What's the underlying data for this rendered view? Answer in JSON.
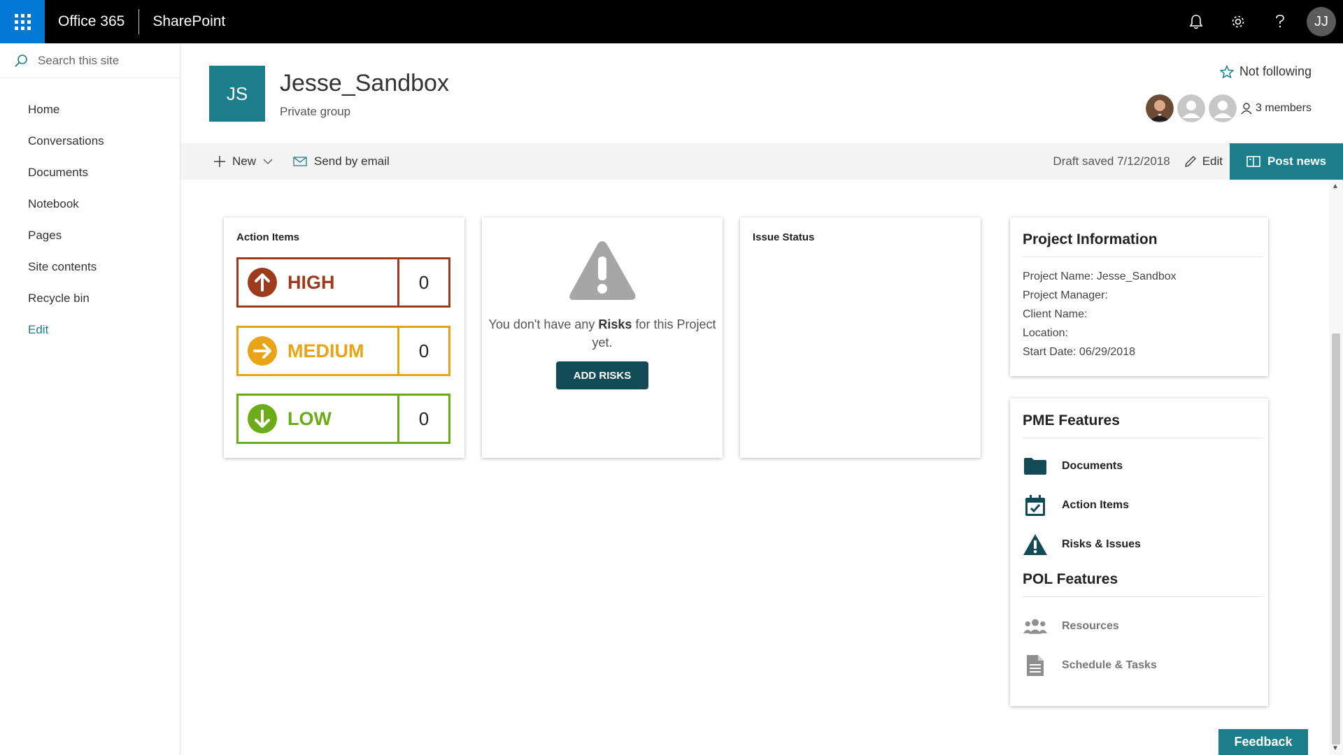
{
  "suite": {
    "app_name": "Office 365",
    "product": "SharePoint",
    "user_initials": "JJ"
  },
  "leftnav": {
    "search_placeholder": "Search this site",
    "items": [
      "Home",
      "Conversations",
      "Documents",
      "Notebook",
      "Pages",
      "Site contents",
      "Recycle bin"
    ],
    "edit_label": "Edit"
  },
  "header": {
    "logo_initials": "JS",
    "title": "Jesse_Sandbox",
    "subtitle": "Private group",
    "follow_label": "Not following",
    "members_label": "3 members"
  },
  "cmdbar": {
    "new_label": "New",
    "email_label": "Send by email",
    "draft_status": "Draft saved 7/12/2018",
    "edit_label": "Edit",
    "post_news_label": "Post news"
  },
  "action_items": {
    "title": "Action Items",
    "rows": [
      {
        "label": "HIGH",
        "count": "0",
        "color": "#9c3c1c"
      },
      {
        "label": "MEDIUM",
        "count": "0",
        "color": "#e8a317"
      },
      {
        "label": "LOW",
        "count": "0",
        "color": "#6cac19"
      }
    ]
  },
  "risks": {
    "message_pre": "You don't have any",
    "message_bold": "Risks",
    "message_post": "for this Project yet.",
    "button_label": "ADD RISKS"
  },
  "issue_status": {
    "title": "Issue Status"
  },
  "project_info": {
    "title": "Project Information",
    "lines": [
      "Project Name: Jesse_Sandbox",
      "Project Manager:",
      "Client Name:",
      "Location:",
      "Start Date: 06/29/2018"
    ]
  },
  "features": {
    "pme_title": "PME Features",
    "pme_items": [
      "Documents",
      "Action Items",
      "Risks & Issues"
    ],
    "pol_title": "POL Features",
    "pol_items": [
      "Resources",
      "Schedule & Tasks"
    ]
  },
  "feedback_label": "Feedback",
  "colors": {
    "brand_teal": "#1b7e8a",
    "dark_teal": "#124b56",
    "suite_blue": "#0078d4"
  }
}
